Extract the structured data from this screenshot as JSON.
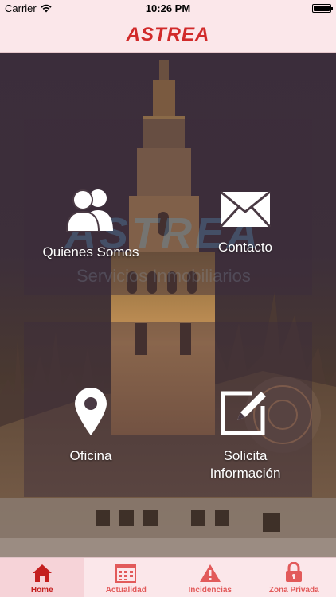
{
  "status_bar": {
    "carrier": "Carrier",
    "time": "10:26 PM"
  },
  "header": {
    "title": "ASTREA"
  },
  "background": {
    "watermark_title": "ASTREA",
    "watermark_subtitle": "Servicios Inmobiliarios"
  },
  "menu": {
    "quienes_somos": "Quienes Somos",
    "contacto": "Contacto",
    "oficina": "Oficina",
    "solicita_line1": "Solicita",
    "solicita_line2": "Información"
  },
  "tabs": [
    {
      "label": "Home",
      "icon": "home-icon",
      "active": true
    },
    {
      "label": "Actualidad",
      "icon": "calendar-icon",
      "active": false
    },
    {
      "label": "Incidencias",
      "icon": "warning-icon",
      "active": false
    },
    {
      "label": "Zona Privada",
      "icon": "lock-icon",
      "active": false
    }
  ],
  "colors": {
    "brand_red": "#d12a2a",
    "bar_background": "#fbe7ea"
  }
}
